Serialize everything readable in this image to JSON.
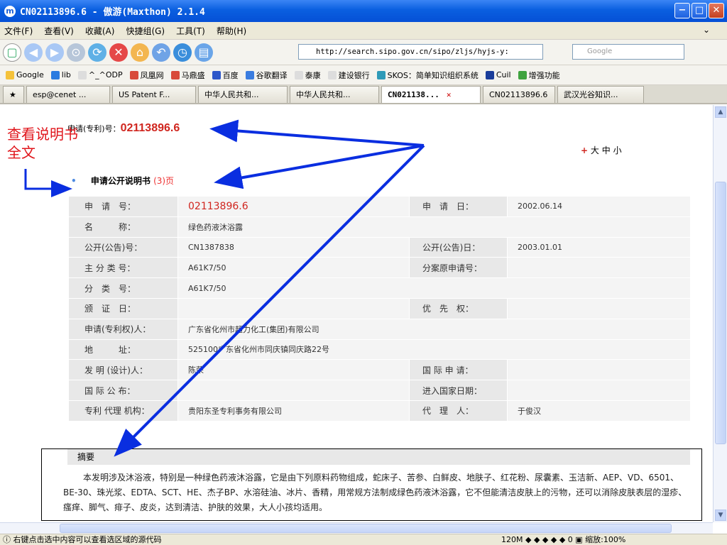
{
  "window": {
    "title": "CN02113896.6 - 傲游(Maxthon) 2.1.4",
    "buttons": {
      "minimize": "−",
      "maximize": "□",
      "close": "✕"
    }
  },
  "menu": [
    "文件(F)",
    "查看(V)",
    "收藏(A)",
    "快捷组(G)",
    "工具(T)",
    "帮助(H)"
  ],
  "address": {
    "url": "http://search.sipo.gov.cn/sipo/zljs/hyjs-y:",
    "search_placeholder": "Google"
  },
  "favorites": [
    "Google",
    "lib",
    "^_^ODP",
    "凤凰网",
    "马鼎盛",
    "百度",
    "谷歌翻译",
    "泰康",
    "建设银行",
    "SKOS：简单知识组织系统",
    "Cuil",
    "增强功能"
  ],
  "tabs": [
    {
      "label": "esp@cenet ..."
    },
    {
      "label": "US Patent F..."
    },
    {
      "label": "中华人民共和..."
    },
    {
      "label": "中华人民共和..."
    },
    {
      "label": "CN021138...",
      "active": true
    },
    {
      "label": "CN02113896.6"
    },
    {
      "label": "武汉光谷知识..."
    }
  ],
  "page": {
    "app_no_label": "申请(专利)号：",
    "app_no_value": "02113896.6",
    "font_size": {
      "plus": "+",
      "big": "大",
      "mid": "中",
      "small": "小"
    },
    "pub_title": "申请公开说明书",
    "pub_pages": "(3)页",
    "annotation": "查看说明书全文",
    "table": {
      "app_no_label": "申　请　号：",
      "app_no": "02113896.6",
      "app_date_label": "申　请　日：",
      "app_date": "2002.06.14",
      "name_label": "名　　　称：",
      "name": "绿色药液沐浴露",
      "pub_no_label": "公开(公告)号：",
      "pub_no": "CN1387838",
      "pub_date_label": "公开(公告)日：",
      "pub_date": "2003.01.01",
      "main_class_label": "主 分 类 号：",
      "main_class": "A61K7/50",
      "div_app_label": "分案原申请号：",
      "div_app": "",
      "class_label": "分　类　号：",
      "class": "A61K7/50",
      "cert_date_label": "颁　证　日：",
      "cert_date": "",
      "priority_label": "优　先　权：",
      "priority": "",
      "applicant_label": "申请(专利权)人：",
      "applicant": "广东省化州市超力化工(集团)有限公司",
      "address_label": "地　　　址：",
      "address": "525100广东省化州市同庆镇同庆路22号",
      "inventor_label": "发 明 (设计)人：",
      "inventor": "陈荣",
      "intl_app_label": "国 际 申 请：",
      "intl_app": "",
      "intl_pub_label": "国 际 公 布：",
      "intl_pub": "",
      "entry_date_label": "进入国家日期：",
      "entry_date": "",
      "agency_label": "专利 代理 机构：",
      "agency": "贵阳东圣专利事务有限公司",
      "agent_label": "代　理　人：",
      "agent": "于俊汉"
    },
    "abstract_head": "摘要",
    "abstract": "本发明涉及沐浴液，特别是一种绿色药液沐浴露，它是由下列原料药物组成，蛇床子、苦参、白鲜皮、地肤子、红花粉、尿囊素、玉洁新、AEP、VD、6501、BE-30、珠光浆、EDTA、SCT、HE、杰子BP、水溶硅油、冰片、香精，用常规方法制成绿色药液沐浴露，它不但能清洁皮肤上的污物，还可以消除皮肤表层的湿疹、瘙痒、脚气、痱子、皮炎，达到清洁、护肤的效果，大人小孩均适用。"
  },
  "status": {
    "hint": "右键点击选中内容可以查看选区域的源代码",
    "memory": "120M",
    "zoom": "缩放:100%"
  },
  "colors": {
    "accent_red": "#d0261f",
    "arrow_blue": "#0a2ee0",
    "title_blue": "#0550d6"
  }
}
